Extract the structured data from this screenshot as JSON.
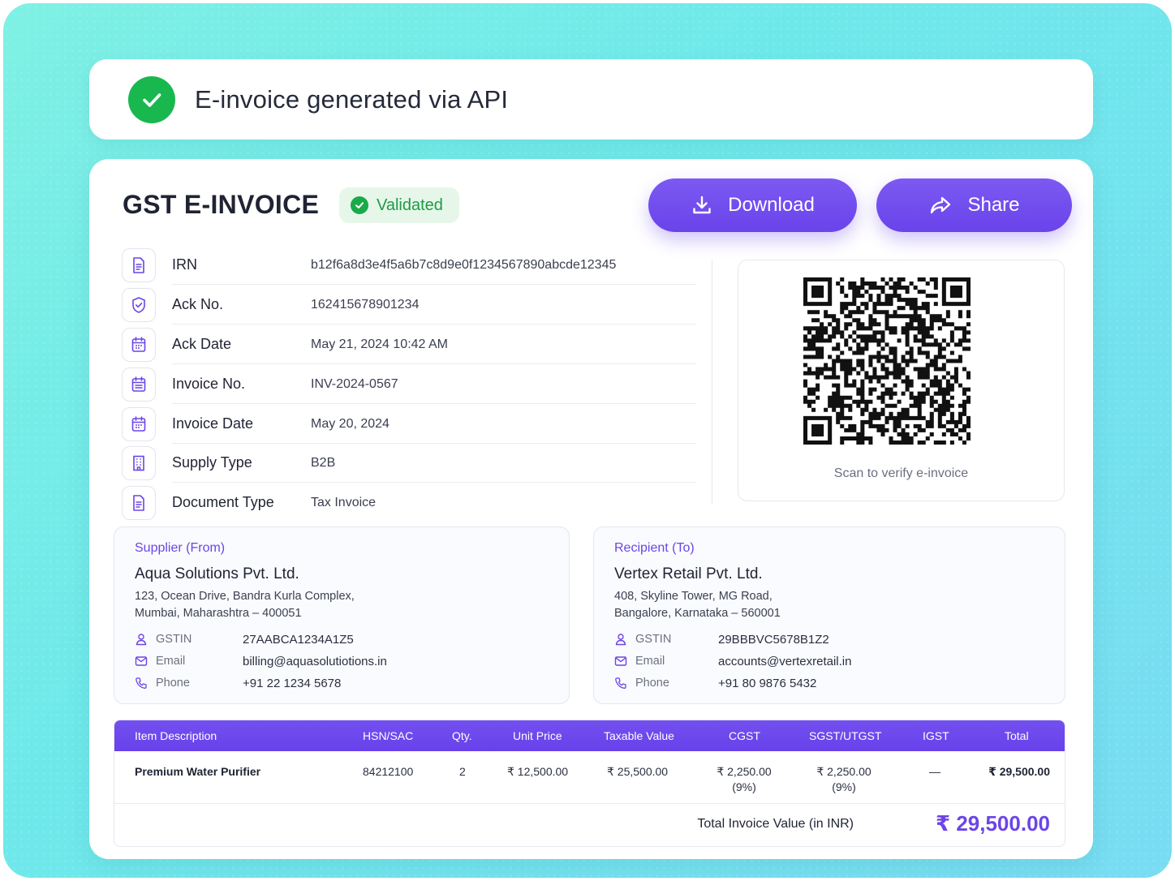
{
  "banner": {
    "title": "E-invoice generated via API",
    "icon": "check-circle-icon",
    "color": "#19b84f"
  },
  "invoice": {
    "title": "GST E-INVOICE",
    "status_badge": "Validated",
    "actions": {
      "download_label": "Download",
      "share_label": "Share"
    },
    "accent_color": "#6b45e6",
    "meta": [
      {
        "icon": "document-icon",
        "label": "IRN",
        "value": "b12f6a8d3e4f5a6b7c8d9e0f1234567890abcde12345"
      },
      {
        "icon": "shield-check-icon",
        "label": "Ack No.",
        "value": "162415678901234"
      },
      {
        "icon": "calendar-icon",
        "label": "Ack Date",
        "value": "May 21, 2024  10:42 AM"
      },
      {
        "icon": "calendar-list-icon",
        "label": "Invoice No.",
        "value": "INV-2024-0567"
      },
      {
        "icon": "calendar-icon",
        "label": "Invoice Date",
        "value": "May 20, 2024"
      },
      {
        "icon": "building-icon",
        "label": "Supply Type",
        "value": "B2B"
      },
      {
        "icon": "document-icon",
        "label": "Document Type",
        "value": "Tax Invoice"
      }
    ],
    "qr": {
      "caption": "Scan to verify e-invoice"
    },
    "supplier": {
      "heading": "Supplier (From)",
      "name": "Aqua Solutions Pvt. Ltd.",
      "address_line1": "123, Ocean Drive, Bandra Kurla Complex,",
      "address_line2": "Mumbai, Maharashtra – 400051",
      "gstin_label": "GSTIN",
      "gstin": "27AABCA1234A1Z5",
      "email_label": "Email",
      "email": "billing@aquasolutiotions.in",
      "phone_label": "Phone",
      "phone": "+91 22 1234 5678"
    },
    "recipient": {
      "heading": "Recipient (To)",
      "name": "Vertex Retail Pvt. Ltd.",
      "address_line1": "408, Skyline Tower, MG Road,",
      "address_line2": "Bangalore, Karnataka – 560001",
      "gstin_label": "GSTIN",
      "gstin": "29BBBVC5678B1Z2",
      "email_label": "Email",
      "email": "accounts@vertexretail.in",
      "phone_label": "Phone",
      "phone": "+91 80 9876 5432"
    },
    "table": {
      "columns": [
        "Item Description",
        "HSN/SAC",
        "Qty.",
        "Unit Price",
        "Taxable Value",
        "CGST",
        "SGST/UTGST",
        "IGST",
        "Total"
      ],
      "rows": [
        {
          "description": "Premium Water Purifier",
          "hsn": "84212100",
          "qty": "2",
          "unit_price": "₹ 12,500.00",
          "taxable_value": "₹ 25,500.00",
          "cgst": "₹ 2,250.00",
          "cgst_rate": "(9%)",
          "sgst": "₹ 2,250.00",
          "sgst_rate": "(9%)",
          "igst": "—",
          "total": "₹ 29,500.00"
        }
      ],
      "total_label": "Total Invoice Value (in INR)",
      "total_value": "₹ 29,500.00"
    }
  }
}
